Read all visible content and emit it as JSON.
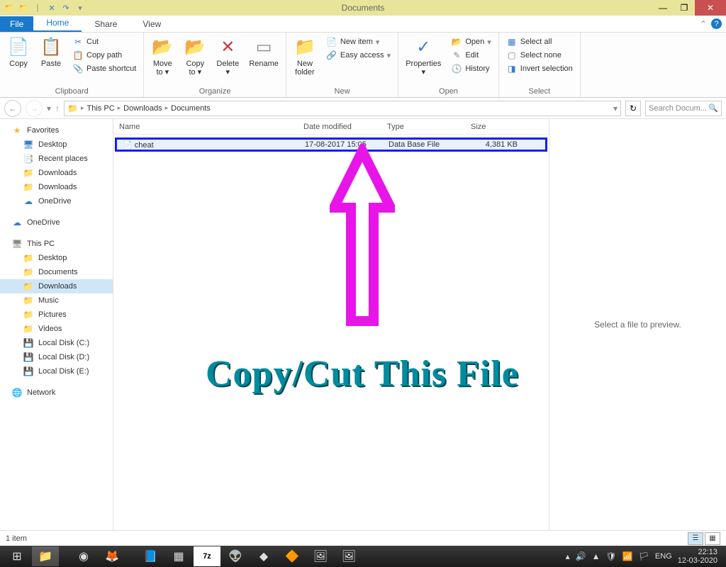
{
  "window": {
    "title": "Documents"
  },
  "tabs": {
    "file": "File",
    "home": "Home",
    "share": "Share",
    "view": "View"
  },
  "ribbon": {
    "clipboard": {
      "label": "Clipboard",
      "copy": "Copy",
      "paste": "Paste",
      "cut": "Cut",
      "copypath": "Copy path",
      "pasteshortcut": "Paste shortcut"
    },
    "organize": {
      "label": "Organize",
      "moveto": "Move\nto",
      "copyto": "Copy\nto",
      "delete": "Delete",
      "rename": "Rename"
    },
    "new": {
      "label": "New",
      "newfolder": "New\nfolder",
      "newitem": "New item",
      "easyaccess": "Easy access"
    },
    "open": {
      "label": "Open",
      "properties": "Properties",
      "open": "Open",
      "edit": "Edit",
      "history": "History"
    },
    "select": {
      "label": "Select",
      "selectall": "Select all",
      "selectnone": "Select none",
      "invert": "Invert selection"
    }
  },
  "breadcrumb": {
    "thispc": "This PC",
    "downloads": "Downloads",
    "documents": "Documents"
  },
  "search": {
    "placeholder": "Search Docum..."
  },
  "nav": {
    "favorites": "Favorites",
    "desktop": "Desktop",
    "recent": "Recent places",
    "downloads": "Downloads",
    "downloads2": "Downloads",
    "onedrive": "OneDrive",
    "onedrive2": "OneDrive",
    "thispc": "This PC",
    "desktop2": "Desktop",
    "documents": "Documents",
    "downloads3": "Downloads",
    "music": "Music",
    "pictures": "Pictures",
    "videos": "Videos",
    "diskc": "Local Disk (C:)",
    "diskd": "Local Disk (D:)",
    "diske": "Local Disk (E:)",
    "network": "Network"
  },
  "columns": {
    "name": "Name",
    "date": "Date modified",
    "type": "Type",
    "size": "Size"
  },
  "file": {
    "name": "cheat",
    "date": "17-08-2017 15:05",
    "type": "Data Base File",
    "size": "4,381 KB"
  },
  "preview": "Select a file to preview.",
  "overlay": "Copy/Cut This File",
  "status": {
    "count": "1 item"
  },
  "tray": {
    "lang": "ENG",
    "time": "22:13",
    "date": "12-03-2020"
  }
}
